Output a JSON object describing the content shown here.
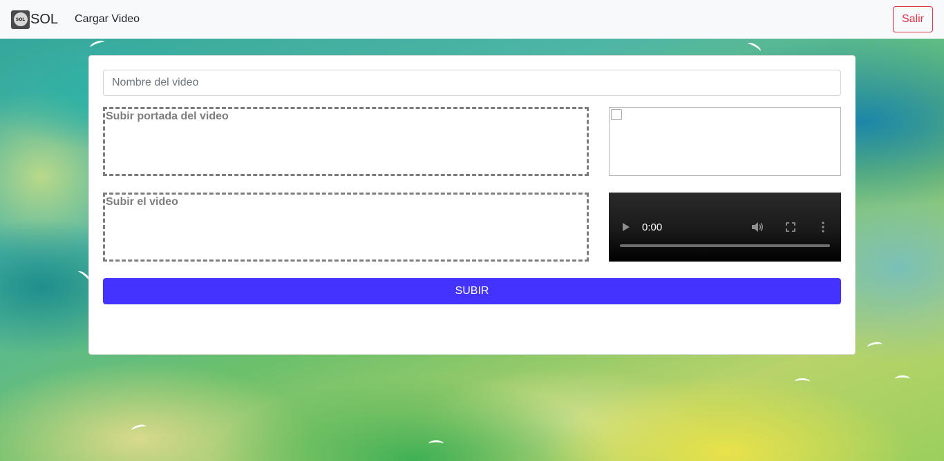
{
  "navbar": {
    "logo_text": "SOL",
    "brand": "SOL",
    "nav_link": "Cargar Video",
    "logout_label": "Salir"
  },
  "form": {
    "name_placeholder": "Nombre del video",
    "name_value": "",
    "cover_dropzone_label": "Subir portada del video",
    "video_dropzone_label": "Subir el video",
    "submit_label": "SUBIR"
  },
  "video_player": {
    "current_time": "0:00",
    "progress": 0
  },
  "icons": {
    "play": "play-icon",
    "volume": "volume-icon",
    "fullscreen": "fullscreen-icon",
    "more": "more-vertical-icon",
    "broken_image": "broken-image-icon"
  },
  "colors": {
    "navbar_bg": "#f8f9fa",
    "logout": "#dc3545",
    "submit_bg": "#4433ff",
    "dropzone_border": "#7d7d7d"
  }
}
